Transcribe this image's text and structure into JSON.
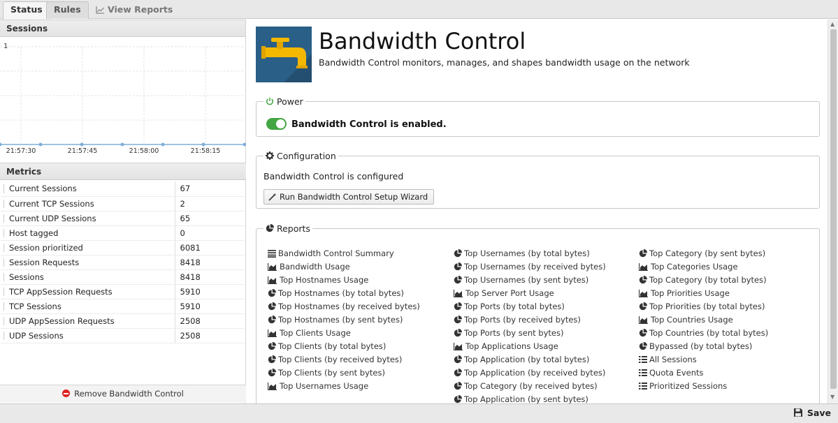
{
  "tabs": [
    {
      "label": "Status"
    },
    {
      "label": "Rules"
    },
    {
      "label": "View Reports"
    }
  ],
  "sessions": {
    "heading": "Sessions",
    "y_label": "1",
    "x_ticks": [
      "21:57:30",
      "21:57:45",
      "21:58:00",
      "21:58:15"
    ]
  },
  "chart_data": {
    "type": "line",
    "title": "Sessions",
    "x": [
      "21:57:30",
      "21:57:45",
      "21:58:00",
      "21:58:15"
    ],
    "series": [
      {
        "values": [
          0,
          0,
          0,
          0
        ]
      }
    ],
    "ylim": [
      0,
      1
    ],
    "grid": true
  },
  "metrics": {
    "heading": "Metrics",
    "rows": [
      {
        "name": "Current Sessions",
        "value": "67"
      },
      {
        "name": "Current TCP Sessions",
        "value": "2"
      },
      {
        "name": "Current UDP Sessions",
        "value": "65"
      },
      {
        "name": "Host tagged",
        "value": "0"
      },
      {
        "name": "Session prioritized",
        "value": "6081"
      },
      {
        "name": "Session Requests",
        "value": "8418"
      },
      {
        "name": "Sessions",
        "value": "8418"
      },
      {
        "name": "TCP AppSession Requests",
        "value": "5910"
      },
      {
        "name": "TCP Sessions",
        "value": "5910"
      },
      {
        "name": "UDP AppSession Requests",
        "value": "2508"
      },
      {
        "name": "UDP Sessions",
        "value": "2508"
      }
    ]
  },
  "remove_label": "Remove Bandwidth Control",
  "app": {
    "title": "Bandwidth Control",
    "description": "Bandwidth Control monitors, manages, and shapes bandwidth usage on the network"
  },
  "power": {
    "legend": "Power",
    "status": "Bandwidth Control is enabled.",
    "enabled": true
  },
  "configuration": {
    "legend": "Configuration",
    "status": "Bandwidth Control is configured",
    "wizard_label": "Run Bandwidth Control Setup Wizard"
  },
  "reports": {
    "legend": "Reports",
    "columns": [
      [
        {
          "label": "Bandwidth Control Summary",
          "icon": "list-lines-icon"
        },
        {
          "label": "Bandwidth Usage",
          "icon": "area-chart-icon"
        },
        {
          "label": "Top Hostnames Usage",
          "icon": "area-chart-icon"
        },
        {
          "label": "Top Hostnames (by total bytes)",
          "icon": "pie-chart-icon"
        },
        {
          "label": "Top Hostnames (by received bytes)",
          "icon": "pie-chart-icon"
        },
        {
          "label": "Top Hostnames (by sent bytes)",
          "icon": "pie-chart-icon"
        },
        {
          "label": "Top Clients Usage",
          "icon": "area-chart-icon"
        },
        {
          "label": "Top Clients (by total bytes)",
          "icon": "pie-chart-icon"
        },
        {
          "label": "Top Clients (by received bytes)",
          "icon": "pie-chart-icon"
        },
        {
          "label": "Top Clients (by sent bytes)",
          "icon": "pie-chart-icon"
        },
        {
          "label": "Top Usernames Usage",
          "icon": "area-chart-icon"
        }
      ],
      [
        {
          "label": "Top Usernames (by total bytes)",
          "icon": "pie-chart-icon"
        },
        {
          "label": "Top Usernames (by received bytes)",
          "icon": "pie-chart-icon"
        },
        {
          "label": "Top Usernames (by sent bytes)",
          "icon": "pie-chart-icon"
        },
        {
          "label": "Top Server Port Usage",
          "icon": "area-chart-icon"
        },
        {
          "label": "Top Ports (by total bytes)",
          "icon": "pie-chart-icon"
        },
        {
          "label": "Top Ports (by received bytes)",
          "icon": "pie-chart-icon"
        },
        {
          "label": "Top Ports (by sent bytes)",
          "icon": "pie-chart-icon"
        },
        {
          "label": "Top Applications Usage",
          "icon": "area-chart-icon"
        },
        {
          "label": "Top Application (by total bytes)",
          "icon": "pie-chart-icon"
        },
        {
          "label": "Top Application (by received bytes)",
          "icon": "pie-chart-icon"
        },
        {
          "label": "Top Category (by received bytes)",
          "icon": "pie-chart-icon"
        },
        {
          "label": "Top Application (by sent bytes)",
          "icon": "pie-chart-icon"
        }
      ],
      [
        {
          "label": "Top Category (by sent bytes)",
          "icon": "pie-chart-icon"
        },
        {
          "label": "Top Categories Usage",
          "icon": "area-chart-icon"
        },
        {
          "label": "Top Category (by total bytes)",
          "icon": "pie-chart-icon"
        },
        {
          "label": "Top Priorities Usage",
          "icon": "area-chart-icon"
        },
        {
          "label": "Top Priorities (by total bytes)",
          "icon": "pie-chart-icon"
        },
        {
          "label": "Top Countries Usage",
          "icon": "area-chart-icon"
        },
        {
          "label": "Top Countries (by total bytes)",
          "icon": "pie-chart-icon"
        },
        {
          "label": "Bypassed (by total bytes)",
          "icon": "pie-chart-icon"
        },
        {
          "label": "All Sessions",
          "icon": "list-bullets-icon"
        },
        {
          "label": "Quota Events",
          "icon": "list-bullets-icon"
        },
        {
          "label": "Prioritized Sessions",
          "icon": "list-bullets-icon"
        }
      ]
    ]
  },
  "save_label": "Save",
  "colors": {
    "accent_green": "#44a544",
    "app_icon_bg": "#2a5f87",
    "tap_yellow": "#f5b800",
    "remove_red": "#e02020"
  }
}
